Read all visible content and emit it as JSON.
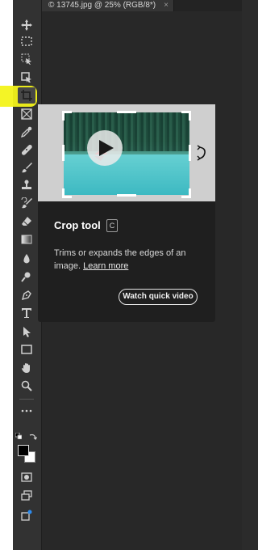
{
  "document_tab": {
    "title": "© 13745.jpg @ 25% (RGB/8*)",
    "close": "×"
  },
  "toolbar": {
    "tools": [
      {
        "name": "move-tool",
        "icon": "move-icon"
      },
      {
        "name": "marquee-tool",
        "icon": "marquee-icon"
      },
      {
        "name": "object-selection-tool",
        "icon": "object-selection-icon"
      },
      {
        "name": "select-subject-tool",
        "icon": "select-subject-icon"
      },
      {
        "name": "crop-tool",
        "icon": "crop-icon",
        "active": true
      },
      {
        "name": "frame-tool",
        "icon": "frame-icon"
      },
      {
        "name": "eyedropper-tool",
        "icon": "eyedropper-icon"
      },
      {
        "name": "healing-brush-tool",
        "icon": "bandage-icon"
      },
      {
        "name": "brush-tool",
        "icon": "brush-icon"
      },
      {
        "name": "clone-stamp-tool",
        "icon": "stamp-icon"
      },
      {
        "name": "history-brush-tool",
        "icon": "history-brush-icon"
      },
      {
        "name": "eraser-tool",
        "icon": "eraser-icon"
      },
      {
        "name": "gradient-tool",
        "icon": "gradient-icon"
      },
      {
        "name": "blur-tool",
        "icon": "drop-icon"
      },
      {
        "name": "dodge-tool",
        "icon": "dodge-icon"
      },
      {
        "name": "pen-tool",
        "icon": "pen-icon"
      },
      {
        "name": "type-tool",
        "icon": "type-icon"
      },
      {
        "name": "path-selection-tool",
        "icon": "arrow-icon"
      },
      {
        "name": "rectangle-tool",
        "icon": "rectangle-icon"
      },
      {
        "name": "hand-tool",
        "icon": "hand-icon"
      },
      {
        "name": "zoom-tool",
        "icon": "zoom-icon"
      },
      {
        "name": "edit-toolbar",
        "icon": "more-icon"
      }
    ],
    "bottom": [
      {
        "name": "quick-mask-button",
        "icon": "quick-mask-icon"
      },
      {
        "name": "screen-mode-button",
        "icon": "screen-mode-icon"
      },
      {
        "name": "share-button",
        "icon": "share-icon"
      }
    ],
    "foreground_color": "#000000",
    "background_color": "#ffffff"
  },
  "tooltip": {
    "title": "Crop tool",
    "shortcut": "C",
    "description": "Trims or expands the edges of an image.",
    "link": "Learn more",
    "button": "Watch quick video"
  },
  "colors": {
    "highlight": "#f3f31a",
    "panel": "#1f1f1f",
    "toolbar": "#323232"
  }
}
